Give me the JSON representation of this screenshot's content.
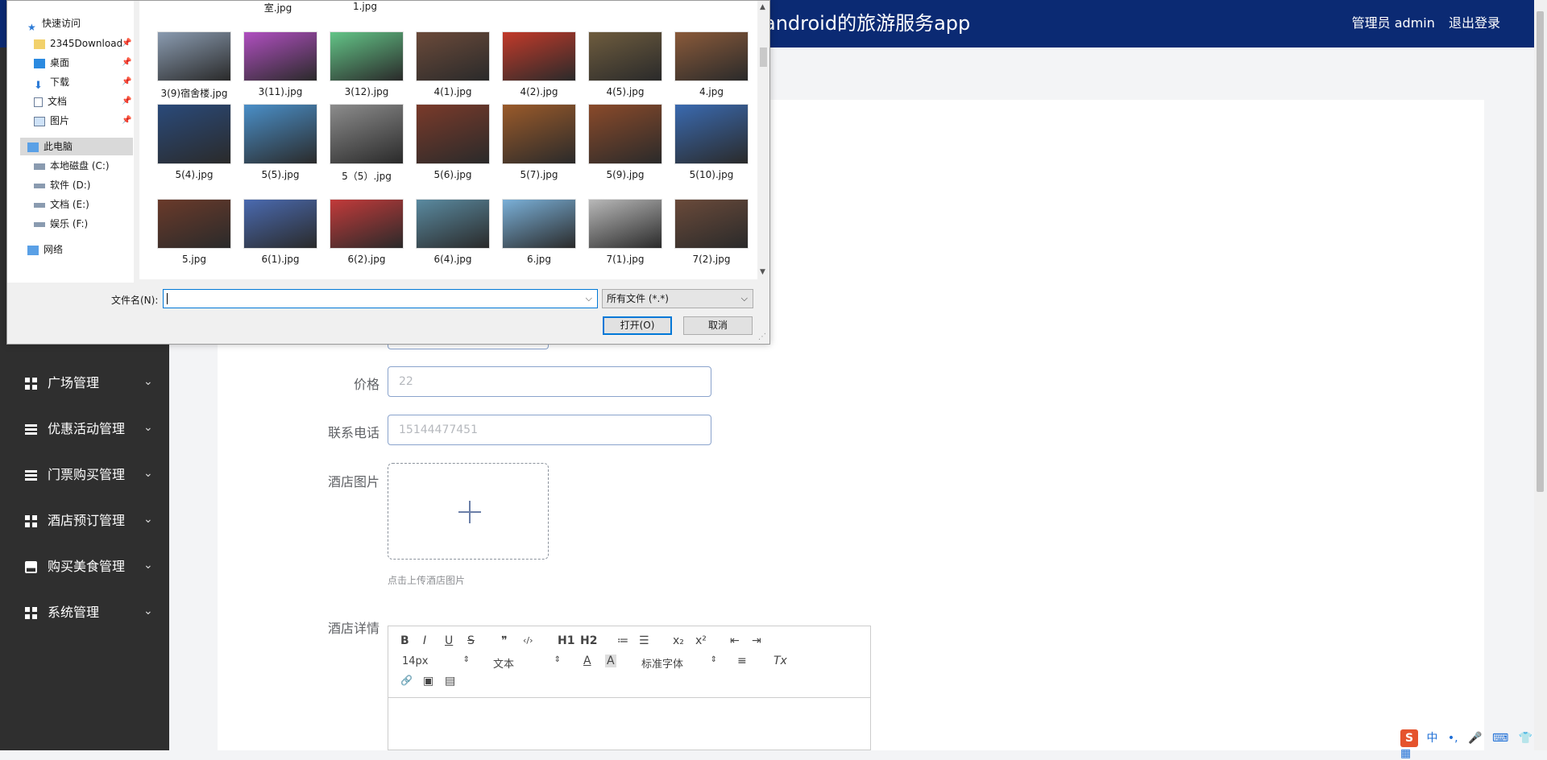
{
  "app": {
    "title": "android的旅游服务app",
    "user_label": "管理员 admin",
    "logout_label": "退出登录"
  },
  "sidebar": {
    "items": [
      {
        "label": "广场管理",
        "icon": "grid-icon"
      },
      {
        "label": "优惠活动管理",
        "icon": "list-icon"
      },
      {
        "label": "门票购买管理",
        "icon": "list-icon"
      },
      {
        "label": "酒店预订管理",
        "icon": "grid-icon"
      },
      {
        "label": "购买美食管理",
        "icon": "tray-icon"
      },
      {
        "label": "系统管理",
        "icon": "grid-icon"
      }
    ],
    "chevron": "⌄"
  },
  "form": {
    "price_label": "价格",
    "price_value": "22",
    "phone_label": "联系电话",
    "phone_value": "15144477451",
    "image_label": "酒店图片",
    "upload_hint": "点击上传酒店图片",
    "detail_label": "酒店详情"
  },
  "editor": {
    "bold": "B",
    "italic": "I",
    "underline": "U",
    "strike": "S",
    "quote": "❞",
    "code": "‹/›",
    "h1": "H1",
    "h2": "H2",
    "ol": "≔",
    "ul": "☰",
    "sub": "x₂",
    "sup": "x²",
    "indent_dec": "⇤",
    "indent_inc": "⇥",
    "size": "14px",
    "text_type": "文本",
    "font_color": "A",
    "bg_color": "A",
    "font_family": "标准字体",
    "align": "≡",
    "clear": "Tx",
    "link": "🔗",
    "image": "▣",
    "video": "▤",
    "updown": "⇕"
  },
  "dialog": {
    "nav": [
      {
        "label": "快速访问",
        "icon": "star-icon"
      },
      {
        "label": "2345Download",
        "icon": "folder-icon",
        "pinned": true
      },
      {
        "label": "桌面",
        "icon": "desktop-icon",
        "pinned": true
      },
      {
        "label": "下载",
        "icon": "download-icon",
        "pinned": true
      },
      {
        "label": "文档",
        "icon": "document-icon",
        "pinned": true
      },
      {
        "label": "图片",
        "icon": "picture-icon",
        "pinned": true
      },
      {
        "label": "此电脑",
        "icon": "computer-icon"
      },
      {
        "label": "本地磁盘 (C:)",
        "icon": "drive-icon"
      },
      {
        "label": "软件 (D:)",
        "icon": "drive-icon"
      },
      {
        "label": "文档 (E:)",
        "icon": "drive-icon"
      },
      {
        "label": "娱乐 (F:)",
        "icon": "drive-icon"
      },
      {
        "label": "网络",
        "icon": "network-icon"
      }
    ],
    "pin_glyph": "📌",
    "top_row": [
      "室.jpg",
      "1.jpg"
    ],
    "files": [
      "3(9)宿舍楼.jpg",
      "3(11).jpg",
      "3(12).jpg",
      "4(1).jpg",
      "4(2).jpg",
      "4(5).jpg",
      "4.jpg",
      "5(4).jpg",
      "5(5).jpg",
      "5（5）.jpg",
      "5(6).jpg",
      "5(7).jpg",
      "5(9).jpg",
      "5(10).jpg",
      "5.jpg",
      "6(1).jpg",
      "6(2).jpg",
      "6(4).jpg",
      "6.jpg",
      "7(1).jpg",
      "7(2).jpg"
    ],
    "thumb_colors": [
      "#8a9bb0",
      "#b04fc0",
      "#63c487",
      "#6b4a3a",
      "#c23a2a",
      "#6e5c3e",
      "#8a5a3a",
      "#2a4a7a",
      "#4a8fc8",
      "#8c8c8c",
      "#7a3a2a",
      "#9a5a2a",
      "#8a4a2a",
      "#3a6ab0",
      "#6a3a2a",
      "#4a6ab0",
      "#c23a3a",
      "#5a8aa0",
      "#7ab0d8",
      "#b8b8b8",
      "#6a4a3a"
    ],
    "filename_label": "文件名(N):",
    "filename_value": "",
    "filetype_value": "所有文件 (*.*)",
    "open_button": "打开(O)",
    "cancel_button": "取消",
    "dropdown_glyph": "⌵",
    "scroll_up": "▲",
    "scroll_down": "▼"
  },
  "ime": {
    "logo": "S",
    "items": [
      "中",
      "•,",
      "🎤",
      "⌨",
      "👕",
      "▦"
    ]
  }
}
